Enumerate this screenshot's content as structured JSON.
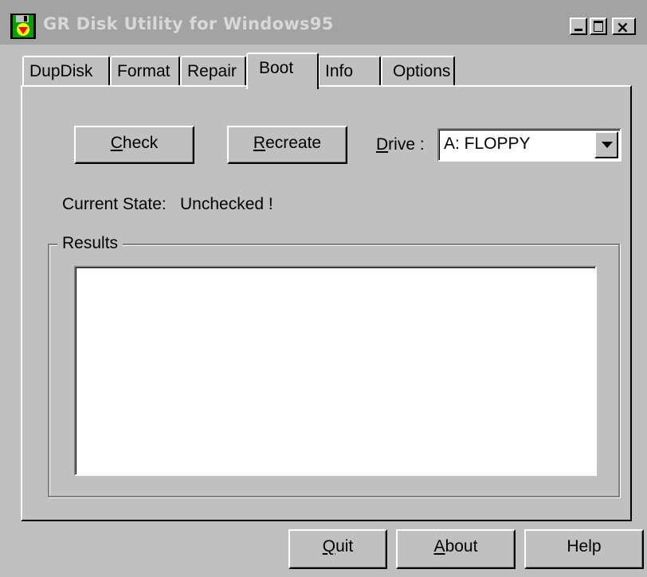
{
  "window": {
    "title": "GR Disk Utility for Windows95",
    "icon": "floppy-disk-icon"
  },
  "tabs": [
    {
      "label": "DupDisk",
      "active": false
    },
    {
      "label": "Format",
      "active": false
    },
    {
      "label": "Repair",
      "active": false
    },
    {
      "label": "Boot",
      "active": true
    },
    {
      "label": "Info",
      "active": false
    },
    {
      "label": "Options",
      "active": false
    }
  ],
  "boot": {
    "check_label_accel": "C",
    "check_label_rest": "heck",
    "recreate_label_accel": "R",
    "recreate_label_rest": "ecreate",
    "drive_label_accel": "D",
    "drive_label_rest": "rive :",
    "drive_value": "A: FLOPPY",
    "state_label": "Current State:",
    "state_value": "Unchecked !",
    "results_title": "Results",
    "results_text": ""
  },
  "footer": {
    "quit_accel": "Q",
    "quit_rest": "uit",
    "about_accel": "A",
    "about_rest": "bout",
    "help_label": "Help"
  },
  "colors": {
    "face": "#c0c0c0",
    "titlebar_inactive": "#a3a3a3",
    "title_text": "#d8d8d8"
  }
}
